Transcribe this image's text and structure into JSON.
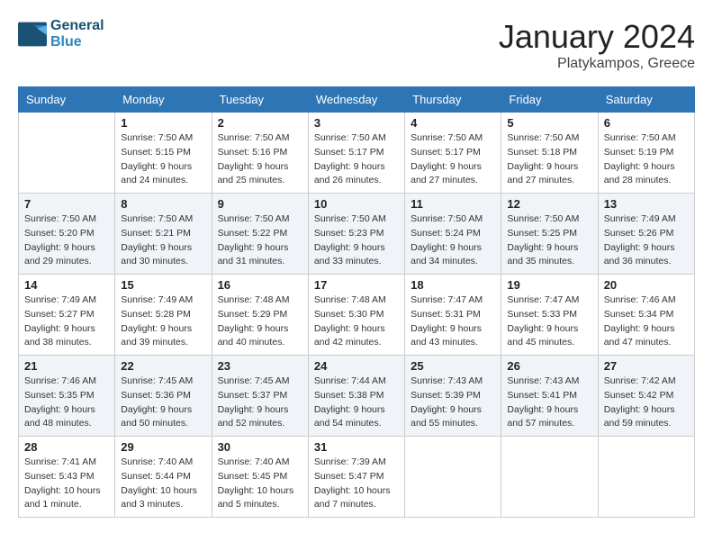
{
  "header": {
    "logo_line1": "General",
    "logo_line2": "Blue",
    "month_title": "January 2024",
    "location": "Platykampos, Greece"
  },
  "weekdays": [
    "Sunday",
    "Monday",
    "Tuesday",
    "Wednesday",
    "Thursday",
    "Friday",
    "Saturday"
  ],
  "weeks": [
    [
      {
        "day": "",
        "sunrise": "",
        "sunset": "",
        "daylight": ""
      },
      {
        "day": "1",
        "sunrise": "Sunrise: 7:50 AM",
        "sunset": "Sunset: 5:15 PM",
        "daylight": "Daylight: 9 hours and 24 minutes."
      },
      {
        "day": "2",
        "sunrise": "Sunrise: 7:50 AM",
        "sunset": "Sunset: 5:16 PM",
        "daylight": "Daylight: 9 hours and 25 minutes."
      },
      {
        "day": "3",
        "sunrise": "Sunrise: 7:50 AM",
        "sunset": "Sunset: 5:17 PM",
        "daylight": "Daylight: 9 hours and 26 minutes."
      },
      {
        "day": "4",
        "sunrise": "Sunrise: 7:50 AM",
        "sunset": "Sunset: 5:17 PM",
        "daylight": "Daylight: 9 hours and 27 minutes."
      },
      {
        "day": "5",
        "sunrise": "Sunrise: 7:50 AM",
        "sunset": "Sunset: 5:18 PM",
        "daylight": "Daylight: 9 hours and 27 minutes."
      },
      {
        "day": "6",
        "sunrise": "Sunrise: 7:50 AM",
        "sunset": "Sunset: 5:19 PM",
        "daylight": "Daylight: 9 hours and 28 minutes."
      }
    ],
    [
      {
        "day": "7",
        "sunrise": "Sunrise: 7:50 AM",
        "sunset": "Sunset: 5:20 PM",
        "daylight": "Daylight: 9 hours and 29 minutes."
      },
      {
        "day": "8",
        "sunrise": "Sunrise: 7:50 AM",
        "sunset": "Sunset: 5:21 PM",
        "daylight": "Daylight: 9 hours and 30 minutes."
      },
      {
        "day": "9",
        "sunrise": "Sunrise: 7:50 AM",
        "sunset": "Sunset: 5:22 PM",
        "daylight": "Daylight: 9 hours and 31 minutes."
      },
      {
        "day": "10",
        "sunrise": "Sunrise: 7:50 AM",
        "sunset": "Sunset: 5:23 PM",
        "daylight": "Daylight: 9 hours and 33 minutes."
      },
      {
        "day": "11",
        "sunrise": "Sunrise: 7:50 AM",
        "sunset": "Sunset: 5:24 PM",
        "daylight": "Daylight: 9 hours and 34 minutes."
      },
      {
        "day": "12",
        "sunrise": "Sunrise: 7:50 AM",
        "sunset": "Sunset: 5:25 PM",
        "daylight": "Daylight: 9 hours and 35 minutes."
      },
      {
        "day": "13",
        "sunrise": "Sunrise: 7:49 AM",
        "sunset": "Sunset: 5:26 PM",
        "daylight": "Daylight: 9 hours and 36 minutes."
      }
    ],
    [
      {
        "day": "14",
        "sunrise": "Sunrise: 7:49 AM",
        "sunset": "Sunset: 5:27 PM",
        "daylight": "Daylight: 9 hours and 38 minutes."
      },
      {
        "day": "15",
        "sunrise": "Sunrise: 7:49 AM",
        "sunset": "Sunset: 5:28 PM",
        "daylight": "Daylight: 9 hours and 39 minutes."
      },
      {
        "day": "16",
        "sunrise": "Sunrise: 7:48 AM",
        "sunset": "Sunset: 5:29 PM",
        "daylight": "Daylight: 9 hours and 40 minutes."
      },
      {
        "day": "17",
        "sunrise": "Sunrise: 7:48 AM",
        "sunset": "Sunset: 5:30 PM",
        "daylight": "Daylight: 9 hours and 42 minutes."
      },
      {
        "day": "18",
        "sunrise": "Sunrise: 7:47 AM",
        "sunset": "Sunset: 5:31 PM",
        "daylight": "Daylight: 9 hours and 43 minutes."
      },
      {
        "day": "19",
        "sunrise": "Sunrise: 7:47 AM",
        "sunset": "Sunset: 5:33 PM",
        "daylight": "Daylight: 9 hours and 45 minutes."
      },
      {
        "day": "20",
        "sunrise": "Sunrise: 7:46 AM",
        "sunset": "Sunset: 5:34 PM",
        "daylight": "Daylight: 9 hours and 47 minutes."
      }
    ],
    [
      {
        "day": "21",
        "sunrise": "Sunrise: 7:46 AM",
        "sunset": "Sunset: 5:35 PM",
        "daylight": "Daylight: 9 hours and 48 minutes."
      },
      {
        "day": "22",
        "sunrise": "Sunrise: 7:45 AM",
        "sunset": "Sunset: 5:36 PM",
        "daylight": "Daylight: 9 hours and 50 minutes."
      },
      {
        "day": "23",
        "sunrise": "Sunrise: 7:45 AM",
        "sunset": "Sunset: 5:37 PM",
        "daylight": "Daylight: 9 hours and 52 minutes."
      },
      {
        "day": "24",
        "sunrise": "Sunrise: 7:44 AM",
        "sunset": "Sunset: 5:38 PM",
        "daylight": "Daylight: 9 hours and 54 minutes."
      },
      {
        "day": "25",
        "sunrise": "Sunrise: 7:43 AM",
        "sunset": "Sunset: 5:39 PM",
        "daylight": "Daylight: 9 hours and 55 minutes."
      },
      {
        "day": "26",
        "sunrise": "Sunrise: 7:43 AM",
        "sunset": "Sunset: 5:41 PM",
        "daylight": "Daylight: 9 hours and 57 minutes."
      },
      {
        "day": "27",
        "sunrise": "Sunrise: 7:42 AM",
        "sunset": "Sunset: 5:42 PM",
        "daylight": "Daylight: 9 hours and 59 minutes."
      }
    ],
    [
      {
        "day": "28",
        "sunrise": "Sunrise: 7:41 AM",
        "sunset": "Sunset: 5:43 PM",
        "daylight": "Daylight: 10 hours and 1 minute."
      },
      {
        "day": "29",
        "sunrise": "Sunrise: 7:40 AM",
        "sunset": "Sunset: 5:44 PM",
        "daylight": "Daylight: 10 hours and 3 minutes."
      },
      {
        "day": "30",
        "sunrise": "Sunrise: 7:40 AM",
        "sunset": "Sunset: 5:45 PM",
        "daylight": "Daylight: 10 hours and 5 minutes."
      },
      {
        "day": "31",
        "sunrise": "Sunrise: 7:39 AM",
        "sunset": "Sunset: 5:47 PM",
        "daylight": "Daylight: 10 hours and 7 minutes."
      },
      {
        "day": "",
        "sunrise": "",
        "sunset": "",
        "daylight": ""
      },
      {
        "day": "",
        "sunrise": "",
        "sunset": "",
        "daylight": ""
      },
      {
        "day": "",
        "sunrise": "",
        "sunset": "",
        "daylight": ""
      }
    ]
  ]
}
